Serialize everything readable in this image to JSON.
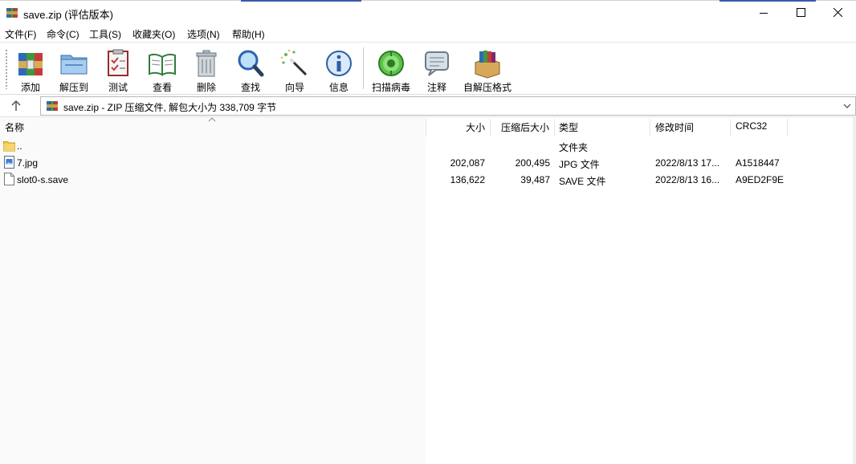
{
  "window": {
    "title": "save.zip (评估版本)"
  },
  "menu": [
    {
      "label": "文件(F)"
    },
    {
      "label": "命令(C)"
    },
    {
      "label": "工具(S)"
    },
    {
      "label": "收藏夹(O)"
    },
    {
      "label": "选项(N)"
    },
    {
      "label": "帮助(H)"
    }
  ],
  "toolbar": {
    "add": "添加",
    "extract_to": "解压到",
    "test": "测试",
    "view": "查看",
    "delete": "删除",
    "find": "查找",
    "wizard": "向导",
    "info": "信息",
    "virus_scan": "扫描病毒",
    "comment": "注释",
    "sfx": "自解压格式"
  },
  "address": {
    "text": "save.zip - ZIP 压缩文件, 解包大小为 338,709 字节"
  },
  "columns": {
    "name": "名称",
    "size": "大小",
    "packed": "压缩后大小",
    "type": "类型",
    "modified": "修改时间",
    "crc": "CRC32"
  },
  "rows": [
    {
      "name": "..",
      "size": "",
      "packed": "",
      "type": "文件夹",
      "modified": "",
      "crc": "",
      "icon": "folder-icon"
    },
    {
      "name": "7.jpg",
      "size": "202,087",
      "packed": "200,495",
      "type": "JPG 文件",
      "modified": "2022/8/13 17...",
      "crc": "A1518447",
      "icon": "image-file-icon"
    },
    {
      "name": "slot0-s.save",
      "size": "136,622",
      "packed": "39,487",
      "type": "SAVE 文件",
      "modified": "2022/8/13 16...",
      "crc": "A9ED2F9E",
      "icon": "blank-file-icon"
    }
  ],
  "colors": {
    "title_accent": "#3b5aa8",
    "folder": "#f2c84b"
  }
}
